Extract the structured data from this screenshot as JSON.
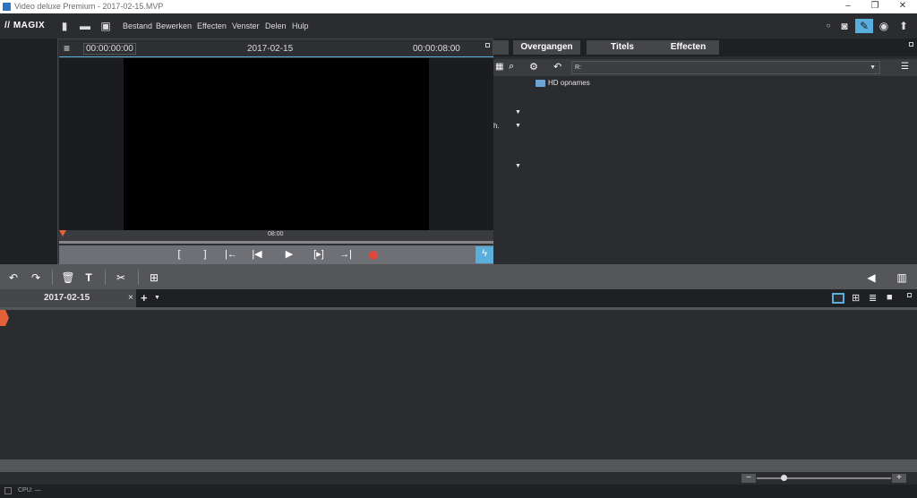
{
  "window": {
    "title": "Video deluxe Premium - 2017-02-15.MVP"
  },
  "menu": {
    "logo": "MAGIX",
    "items": [
      "Bestand",
      "Bewerken",
      "Effecten",
      "Venster",
      "Delen",
      "Hulp"
    ]
  },
  "preview": {
    "timecode_left": "00:00:00:00",
    "title": "2017-02-15",
    "timecode_right": "00:00:08:00",
    "scrub_marker": "08:00"
  },
  "media_pool": {
    "tabs": [
      "Overgangen",
      "Titels",
      "Effecten"
    ],
    "path": "R:",
    "tree_fragment": "h.",
    "files": [
      {
        "name": "HD opnames",
        "icon": "folder-icon"
      }
    ]
  },
  "arranger": {
    "tab_label": "2017-02-15",
    "tab_close": "×",
    "add_tab": "+"
  },
  "status": {
    "cpu": "CPU: —"
  },
  "colors": {
    "accent": "#5aaedb",
    "record": "#e0483b",
    "marker": "#e2603a"
  }
}
